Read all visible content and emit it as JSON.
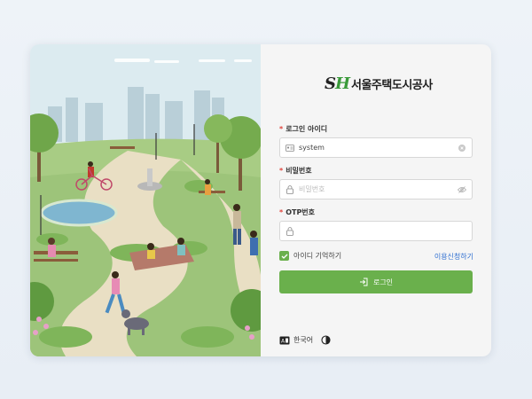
{
  "brand": {
    "logo_mark_s": "S",
    "logo_mark_h": "H",
    "name": "서울주택도시공사"
  },
  "login_form": {
    "id_label": "로그인 아이디",
    "id_value": "system",
    "password_label": "비밀번호",
    "password_placeholder": "비밀번호",
    "otp_label": "OTP번호",
    "otp_placeholder": "",
    "remember_label": "아이디 기억하기",
    "remember_checked": true,
    "apply_link": "이용신청하기",
    "login_button": "로그인"
  },
  "footer": {
    "language_label": "한국어"
  },
  "colors": {
    "accent": "#6ab04c",
    "link": "#2f6fd1",
    "required": "#e0433b"
  },
  "icons": [
    "id-card-icon",
    "clear-icon",
    "lock-icon",
    "eye-off-icon",
    "login-icon",
    "language-icon",
    "dark-mode-icon",
    "check-icon"
  ]
}
